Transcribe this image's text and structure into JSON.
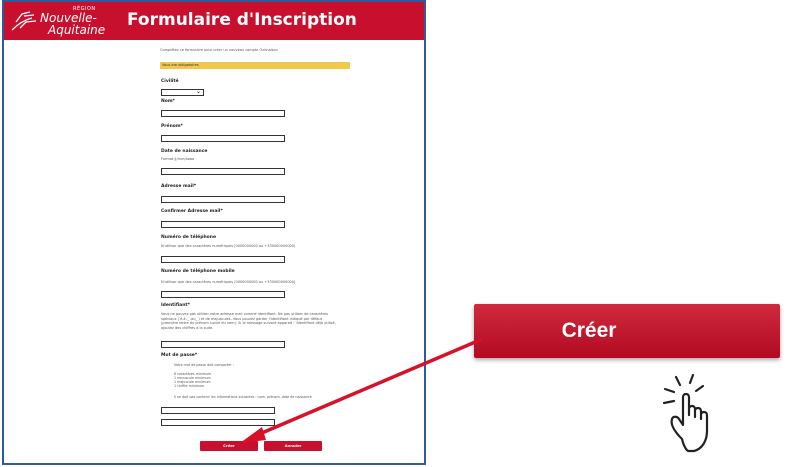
{
  "header": {
    "logo_region": "RÉGION",
    "logo_line1": "Nouvelle-",
    "logo_line2": "Aquitaine",
    "title": "Formulaire d'Inscription"
  },
  "form": {
    "intro": "Complétez ce formulaire pour créer un nouveau compte Ozimaison",
    "notice": "Vous are obligatoires",
    "civilite_label": "Civilité",
    "nom_label": "Nom*",
    "prenom_label": "Prénom*",
    "naissance_label": "Date de naissance",
    "naissance_hint": "Format jj/mm/aaaa",
    "email_label": "Adresse mail*",
    "email_confirm_label": "Confirmer Adresse mail*",
    "phone_label": "Numéro de téléphone",
    "phone_hint": "N'utiliser que des caractères numériques (0000000000 ou +330000000000)",
    "mobile_label": "Numéro de téléphone mobile",
    "mobile_hint": "N'utiliser que des caractères numériques (0000000000 ou +330000000000)",
    "identifiant_label": "Identifiant*",
    "identifiant_hint": "Vous ne pouvez pas utiliser votre adresse mail comme identifiant. Ne pas utiliser de caractères spéciaux ( é-è-_ -ou_ ) et de majuscules. Vous pouvez garder l'identifiant indiqué par défaut (première lettre du prénom suivie du nom). Si le message suivant apparaît : 'Identifiant déjà utilisé, ajoutez des chiffres à la suite.",
    "password_label": "Mot de passe*",
    "password_intro": "Votre mot de passe doit comporter :",
    "password_rules": [
      "8 caractères minimum",
      "1 minuscule minimum",
      "1 majuscule minimum",
      "1 chiffre minimum"
    ],
    "password_note": "Il ne doit pas contenir les informations suivantes : nom, prénom, date de naissance",
    "create_button": "Créer",
    "cancel_button": "Annuler"
  },
  "callout": {
    "button_label": "Créer"
  },
  "colors": {
    "brand_red": "#c8102e",
    "notice_yellow": "#f2c84b",
    "frame_blue": "#2e5c9a"
  },
  "icons": {
    "hand": "tap-hand-icon",
    "arrow": "pointer-arrow"
  }
}
